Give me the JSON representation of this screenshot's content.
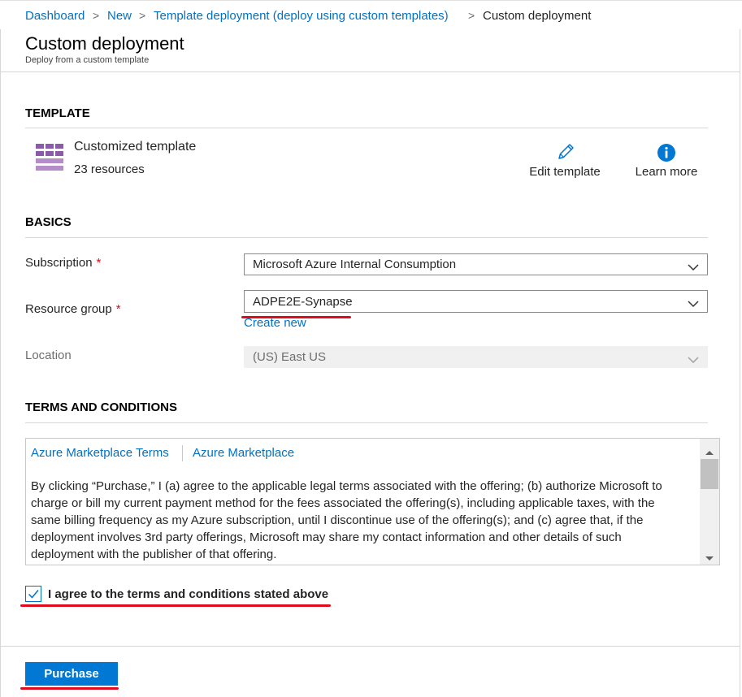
{
  "breadcrumb": {
    "items": [
      "Dashboard",
      "New",
      "Template deployment (deploy using custom templates)"
    ],
    "current": "Custom deployment",
    "separator": ">"
  },
  "header": {
    "title": "Custom deployment",
    "subtitle": "Deploy from a custom template"
  },
  "template": {
    "heading": "TEMPLATE",
    "name": "Customized template",
    "resources": "23 resources",
    "icon": "template-grid-icon",
    "edit_label": "Edit template",
    "learn_label": "Learn more"
  },
  "basics": {
    "heading": "BASICS",
    "required_marker": "*",
    "subscription_label": "Subscription",
    "subscription_value": "Microsoft Azure Internal Consumption",
    "resource_group_label": "Resource group",
    "resource_group_value": "ADPE2E-Synapse",
    "create_new": "Create new",
    "location_label": "Location",
    "location_value": "(US) East US"
  },
  "terms": {
    "heading": "TERMS AND CONDITIONS",
    "tab1": "Azure Marketplace Terms",
    "tab2": "Azure Marketplace",
    "lines": [
      "By clicking “Purchase,” I (a) agree to the applicable legal terms associated with the offering; (b) authorize Microsoft to",
      "charge or bill my current payment method for the fees associated the offering(s), including applicable taxes, with the",
      "same billing frequency as my Azure subscription, until I discontinue use of the offering(s); and (c) agree that, if the",
      "deployment involves 3rd party offerings, Microsoft may share my contact information and other details of such",
      "deployment with the publisher of that offering."
    ],
    "agree_label": "I agree to the terms and conditions stated above",
    "agree_checked": true
  },
  "footer": {
    "purchase_label": "Purchase"
  },
  "colors": {
    "accent": "#0072c6",
    "button": "#0078d4",
    "required": "#e00b1c",
    "highlight_underline": "#e00b1c",
    "template_icon": "#8b5aa8"
  }
}
